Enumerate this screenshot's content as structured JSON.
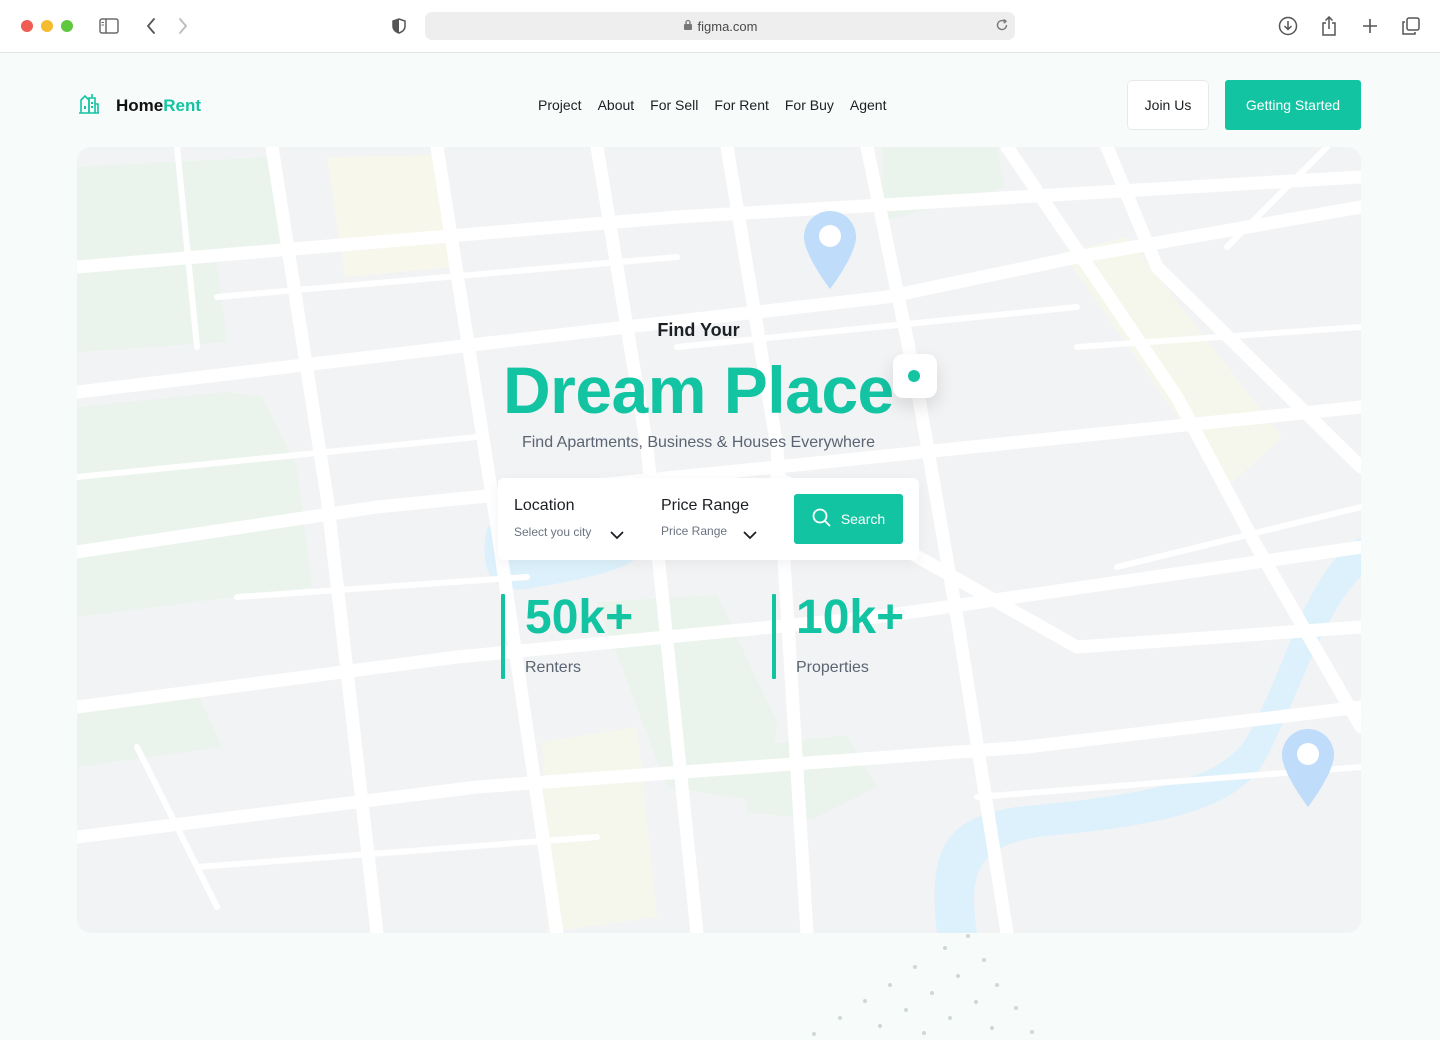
{
  "browser": {
    "url": "figma.com"
  },
  "brand": {
    "name_part1": "Home",
    "name_part2": "Rent",
    "accent_color": "#13c4a3"
  },
  "nav": {
    "items": [
      "Project",
      "About",
      "For Sell",
      "For Rent",
      "For Buy",
      "Agent"
    ]
  },
  "header_actions": {
    "join_label": "Join Us",
    "start_label": "Getting Started"
  },
  "hero": {
    "eyebrow": "Find Your",
    "headline": "Dream Place",
    "subtitle": "Find Apartments, Business & Houses Everywhere"
  },
  "search": {
    "location_label": "Location",
    "location_value": "Select you city",
    "price_label": "Price Range",
    "price_value": "Price Range",
    "button_label": "Search"
  },
  "stats": [
    {
      "value": "50k+",
      "label": "Renters"
    },
    {
      "value": "10k+",
      "label": "Properties"
    }
  ],
  "icons": {
    "sidebar": "sidebar-icon",
    "back": "chevron-left-icon",
    "forward": "chevron-right-icon",
    "shield": "shield-icon",
    "lock": "lock-icon",
    "reload": "reload-icon",
    "download": "download-icon",
    "share": "share-icon",
    "new_tab": "plus-icon",
    "tabs": "tabs-icon",
    "logo": "building-icon",
    "map_pin": "map-pin-icon",
    "search": "search-icon",
    "dropdown": "chevron-down-icon"
  }
}
